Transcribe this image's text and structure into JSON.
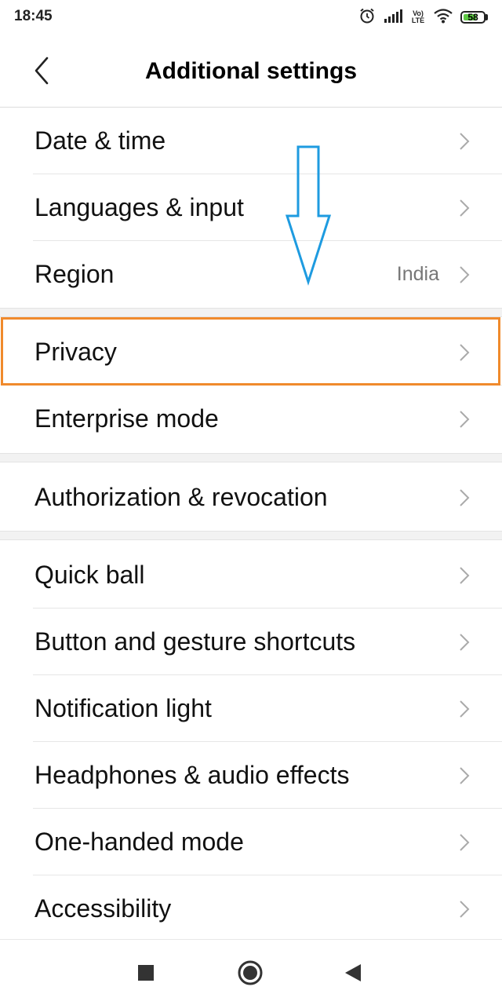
{
  "status_bar": {
    "time": "18:45",
    "network_label_top": "Vo)",
    "network_label_bottom": "LTE",
    "battery_level": "58"
  },
  "header": {
    "title": "Additional settings",
    "back_icon": "chevron-left-icon"
  },
  "sections": [
    {
      "items": [
        {
          "label": "Date & time",
          "value": ""
        },
        {
          "label": "Languages & input",
          "value": ""
        },
        {
          "label": "Region",
          "value": "India"
        }
      ]
    },
    {
      "items": [
        {
          "label": "Privacy",
          "value": ""
        },
        {
          "label": "Enterprise mode",
          "value": ""
        }
      ]
    },
    {
      "items": [
        {
          "label": "Authorization & revocation",
          "value": ""
        }
      ]
    },
    {
      "items": [
        {
          "label": "Quick ball",
          "value": ""
        },
        {
          "label": "Button and gesture shortcuts",
          "value": ""
        },
        {
          "label": "Notification light",
          "value": ""
        },
        {
          "label": "Headphones & audio effects",
          "value": ""
        },
        {
          "label": "One-handed mode",
          "value": ""
        },
        {
          "label": "Accessibility",
          "value": ""
        }
      ]
    }
  ],
  "annotations": {
    "arrow_color": "#1e9be0",
    "highlight_color": "#f08a2c"
  },
  "nav_bar": {
    "icons": [
      "recents-square-icon",
      "home-circle-icon",
      "back-triangle-icon"
    ]
  }
}
